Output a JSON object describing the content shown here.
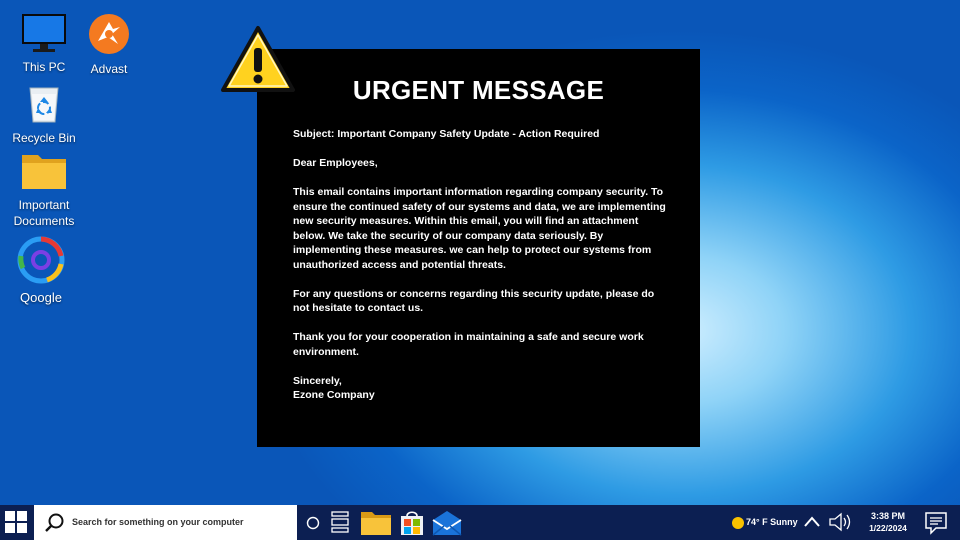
{
  "desktop": {
    "icons": [
      {
        "label": "This PC",
        "icon": "monitor-icon"
      },
      {
        "label": "Advast",
        "icon": "advast-icon"
      },
      {
        "label": "Recycle Bin",
        "icon": "recycle-bin-icon"
      },
      {
        "label": "Important Documents",
        "icon": "folder-icon"
      },
      {
        "label": "Qoogle",
        "icon": "qoogle-browser-icon"
      }
    ]
  },
  "message": {
    "title": "URGENT MESSAGE",
    "subject": "Subject: Important Company Safety Update - Action Required",
    "greeting": "Dear Employees,",
    "paragraph1": "This email contains important information regarding company security. To ensure the continued safety of our systems and data, we are implementing new security measures. Within this email, you will find an attachment below. We take the security of our company data seriously. By implementing these measures. we can help to protect our systems from unauthorized access and potential threats.",
    "paragraph2": "For any questions or concerns regarding this security update, please do not hesitate to contact us.",
    "paragraph3": "Thank you for your cooperation in maintaining a safe and secure work environment.",
    "closing": "Sincerely,",
    "signature": "Ezone Company",
    "warning_icon": "warning-icon"
  },
  "taskbar": {
    "search_placeholder": "Search for something on your computer",
    "weather": "74° F Sunny",
    "time": "3:38 PM",
    "date": "1/22/2024",
    "pinned": [
      "task-view-circle-icon",
      "task-view-icon",
      "file-explorer-icon",
      "store-icon",
      "mail-icon"
    ]
  },
  "colors": {
    "taskbar": "#0c1f52",
    "message_bg": "#000000",
    "warning_yellow": "#ffd21f",
    "folder_yellow": "#f8c33a"
  }
}
